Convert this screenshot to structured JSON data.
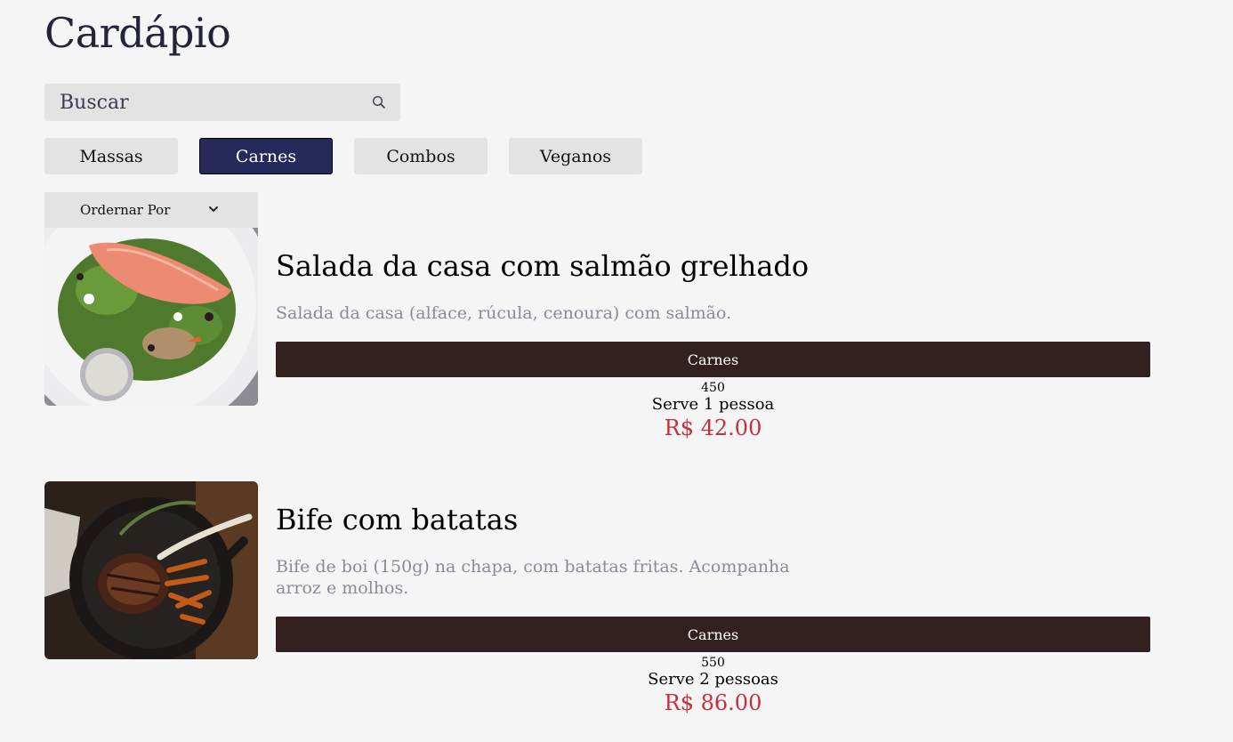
{
  "page": {
    "title": "Cardápio"
  },
  "search": {
    "placeholder": "Buscar",
    "icon": "search-icon"
  },
  "tabs": [
    {
      "label": "Massas",
      "active": false
    },
    {
      "label": "Carnes",
      "active": true
    },
    {
      "label": "Combos",
      "active": false
    },
    {
      "label": "Veganos",
      "active": false
    }
  ],
  "sort": {
    "label": "Ordernar Por",
    "icon": "chevron-down-icon"
  },
  "items": [
    {
      "name": "Salada da casa com salmão grelhado",
      "description": "Salada da casa (alface, rúcula, cenoura) com salmão.",
      "category": "Carnes",
      "weight": "450",
      "serves": "Serve 1 pessoa",
      "price": "R$ 42.00"
    },
    {
      "name": "Bife com batatas",
      "description": "Bife de boi (150g) na chapa, com batatas fritas. Acompanha arroz e molhos.",
      "category": "Carnes",
      "weight": "550",
      "serves": "Serve 2 pessoas",
      "price": "R$ 86.00"
    }
  ],
  "colors": {
    "accent": "#262a5a",
    "category_bar": "#32211f",
    "price": "#c62f3c",
    "background": "#f5f5f5"
  }
}
